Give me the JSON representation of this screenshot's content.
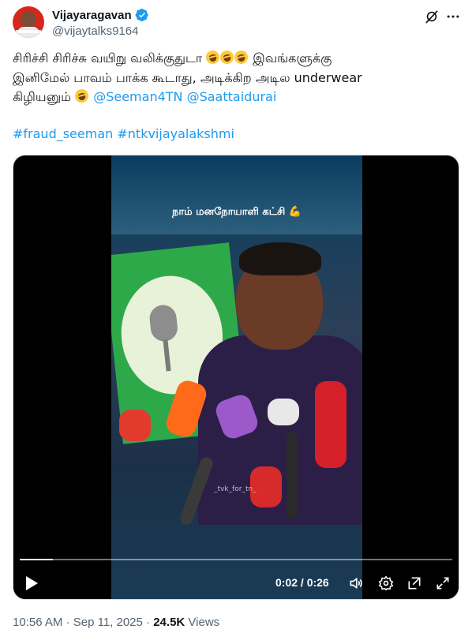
{
  "author": {
    "display_name": "Vijayaragavan",
    "handle": "@vijaytalks9164",
    "verified": true
  },
  "tweet": {
    "text_line1": "சிரிச்சி சிரிச்சு வயிறு வலிக்குதுடா ",
    "text_line1_after": " இவங்களுக்கு",
    "text_line2": "இனிமேல் பாவம் பாக்க கூடாது, அடிக்கிற அடில underwear",
    "text_line3": "கிழியனும் ",
    "mention1": "@Seeman4TN",
    "mention2": "@Saattaidurai",
    "hashtag1": "#fraud_seeman",
    "hashtag2": "#ntkvijayalakshmi",
    "emoji_name": "rolling-on-the-floor-laughing"
  },
  "video": {
    "banner_text": "நாம் மனநோயாளி கட்சி 💪",
    "watermark": "_tvk_for_tn_",
    "time": "0:02 / 0:26",
    "progress": 0.077
  },
  "meta": {
    "time": "10:56 AM",
    "sep": " · ",
    "date": "Sep 11, 2025",
    "views_count": "24.5K",
    "views_label": " Views"
  },
  "colors": {
    "accent": "#1d9bf0",
    "text": "#0f1419",
    "secondary": "#536471"
  }
}
